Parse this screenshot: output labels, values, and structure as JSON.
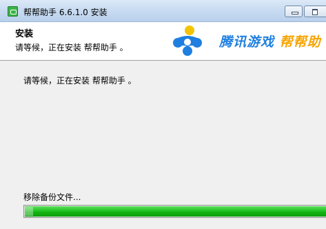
{
  "window": {
    "title": "帮帮助手 6.6.1.0 安装",
    "icon": "gamepad-icon"
  },
  "header": {
    "title": "安装",
    "subtitle": "请等候，正在安装 帮帮助手 。",
    "brand_primary": "腾讯游戏",
    "brand_secondary": "帮帮助",
    "brand_colors": {
      "primary": "#1f7fe0",
      "secondary": "#f7a400"
    }
  },
  "main": {
    "message": "请等候，正在安装 帮帮助手 。",
    "status": "移除备份文件...",
    "progress_fraction": 1.0,
    "progress_color": "#1bbb1b"
  }
}
